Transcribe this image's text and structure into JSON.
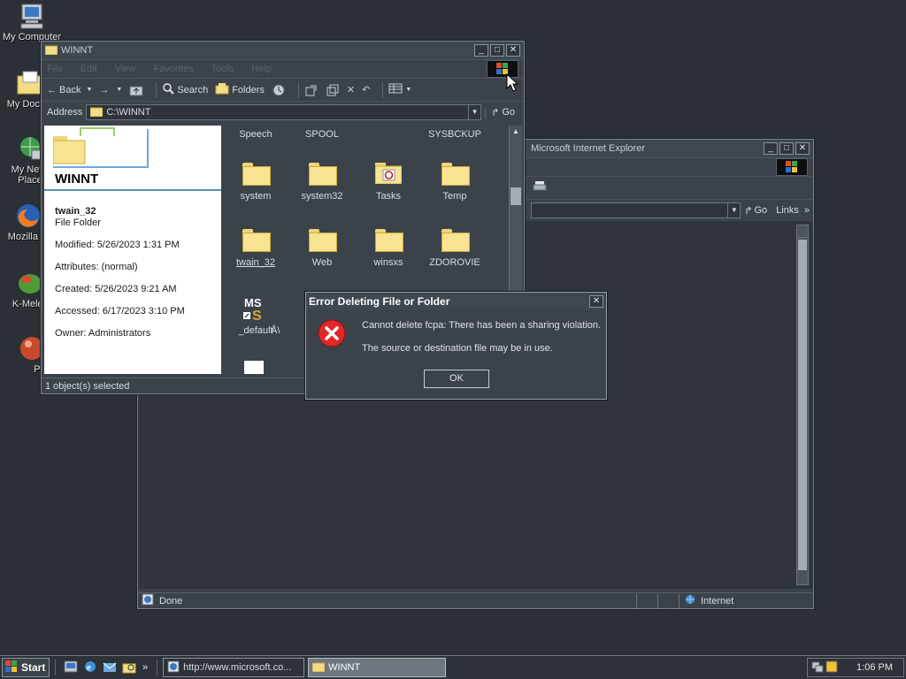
{
  "desktop": {
    "icons": [
      {
        "label": "My Computer",
        "icon": "computer-icon"
      },
      {
        "label": "My Docum",
        "icon": "documents-folder-icon"
      },
      {
        "label": "My Netw",
        "sublabel": "Place",
        "icon": "network-icon"
      },
      {
        "label": "Mozilla Fi",
        "icon": "firefox-icon"
      },
      {
        "label": "K-Melec",
        "icon": "kmeleon-icon"
      },
      {
        "label": "Peg",
        "icon": "pegasus-icon"
      }
    ]
  },
  "ie_window": {
    "title": "Microsoft Internet Explorer",
    "go_label": "Go",
    "links_label": "Links",
    "status_text": "Done",
    "zone_text": "Internet"
  },
  "explorer": {
    "title": "WINNT",
    "menu": [
      "File",
      "Edit",
      "View",
      "Favorites",
      "Tools",
      "Help"
    ],
    "toolbar": {
      "back": "Back",
      "search": "Search",
      "folders": "Folders"
    },
    "address_label": "Address",
    "address_value": "C:\\WINNT",
    "go_label": "Go",
    "panel": {
      "folder_name": "WINNT",
      "selected_name": "twain_32",
      "selected_type": "File Folder",
      "modified": "Modified: 5/26/2023 1:31 PM",
      "attributes": "Attributes: (normal)",
      "created": "Created: 5/26/2023 9:21 AM",
      "accessed": "Accessed: 6/17/2023 3:10 PM",
      "owner": "Owner: Administrators"
    },
    "top_row": [
      "Speech",
      "SPOOL",
      "",
      "SYSBCKUP"
    ],
    "items": [
      {
        "label": "system",
        "icon": "folder-icon"
      },
      {
        "label": "system32",
        "icon": "folder-icon"
      },
      {
        "label": "Tasks",
        "icon": "tasks-folder-icon"
      },
      {
        "label": "Temp",
        "icon": "folder-icon"
      },
      {
        "label": "twain_32",
        "icon": "folder-icon"
      },
      {
        "label": "Web",
        "icon": "folder-icon"
      },
      {
        "label": "winsxs",
        "icon": "folder-icon"
      },
      {
        "label": "ZDOROVIE",
        "icon": "folder-icon"
      },
      {
        "label": "_default",
        "icon": "ms-shortcut-icon"
      },
      {
        "label": "Å\\",
        "icon": "file-icon"
      }
    ],
    "status_text": "1 object(s) selected"
  },
  "dialog": {
    "title": "Error Deleting File or Folder",
    "message": "Cannot delete fcpa: There has been a sharing violation.",
    "detail": "The source or destination file may be in use.",
    "ok_label": "OK"
  },
  "taskbar": {
    "start_label": "Start",
    "tasks": [
      {
        "label": "http://www.microsoft.co...",
        "icon": "ie-page-icon"
      },
      {
        "label": "WINNT",
        "icon": "folder-icon"
      }
    ],
    "clock": "1:06 PM"
  },
  "colors": {
    "error_red": "#e02828",
    "folder_yellow": "#f7e392",
    "desktop": "#2a3036"
  }
}
